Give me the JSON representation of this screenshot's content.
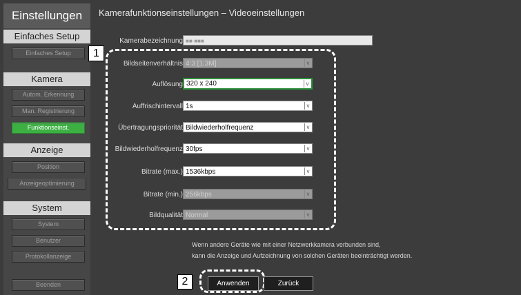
{
  "sidebar": {
    "title": "Einstellungen",
    "sections": [
      {
        "label": "Einfaches Setup",
        "items": [
          "Einfaches Setup"
        ]
      },
      {
        "label": "Kamera",
        "items": [
          "Autom. Erkennung",
          "Man. Registrierung",
          "Funktionseinst."
        ]
      },
      {
        "label": "Anzeige",
        "items": [
          "Position",
          "Anzeigeoptimierung"
        ]
      },
      {
        "label": "System",
        "items": [
          "System",
          "Benutzer",
          "Protokollanzeige"
        ]
      }
    ],
    "active_item": "Funktionseinst.",
    "exit": "Beenden"
  },
  "main": {
    "title": "Kamerafunktionseinstellungen – Videoeinstellungen",
    "camera_name_label": "Kamerabezeichnung",
    "camera_name_value": "■■-■■■",
    "fields": [
      {
        "label": "Bildseitenverhältnis",
        "value": "4:3 [1.3M]",
        "enabled": false
      },
      {
        "label": "Auflösung",
        "value": "320 x 240",
        "enabled": true,
        "selected": true
      },
      {
        "label": "Auffrischintervall",
        "value": "1s",
        "enabled": true
      },
      {
        "label": "Übertragungspriorität",
        "value": "Bildwiederholfrequenz",
        "enabled": true
      },
      {
        "label": "Bildwiederholfrequenz",
        "value": "30fps",
        "enabled": true
      },
      {
        "label": "Bitrate (max.)",
        "value": "1536kbps",
        "enabled": true
      },
      {
        "label": "Bitrate (min.)",
        "value": "256kbps",
        "enabled": false
      },
      {
        "label": "Bildqualität",
        "value": "Normal",
        "enabled": false
      }
    ],
    "info_lines": [
      "Wenn andere Geräte wie mit einer Netzwerkkamera verbunden sind,",
      "kann die Anzeige und Aufzeichnung von solchen Geräten beeinträchtigt werden."
    ],
    "apply_button": "Anwenden",
    "back_button": "Zurück"
  },
  "callouts": {
    "one": "1",
    "two": "2"
  },
  "icons": {
    "dropdown": "chevron-down-icon"
  },
  "colors": {
    "active": "#3cb043",
    "selected_border": "#2b8f3a"
  }
}
